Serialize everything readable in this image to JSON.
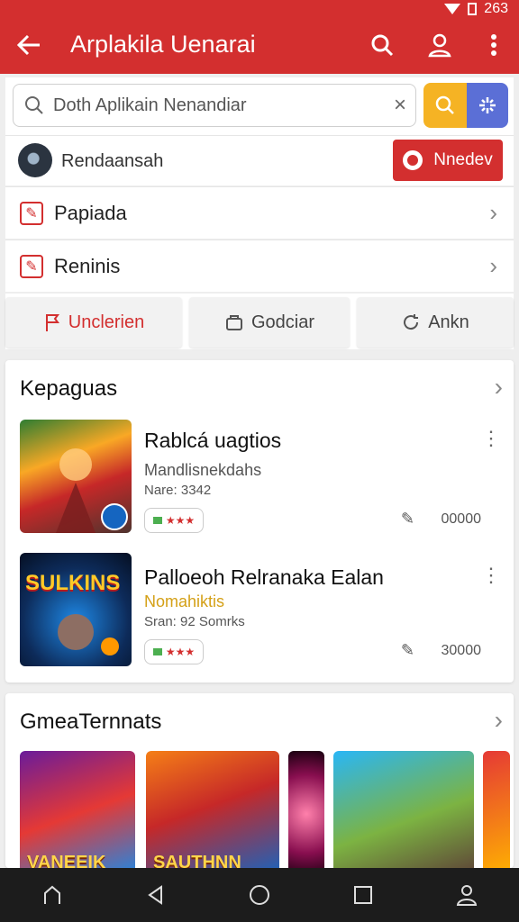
{
  "status_bar": {
    "time": "263"
  },
  "appbar": {
    "title": "Arplakila Uenarai",
    "back_icon": "arrow-left-icon",
    "actions": [
      "search-icon",
      "user-icon",
      "more-vert-icon"
    ]
  },
  "search": {
    "placeholder": "Doth Aplikain Nenandiar",
    "clear_icon": "close-icon",
    "search_button_icon": "search-icon",
    "filter_button_icon": "sparkle-icon"
  },
  "user": {
    "name": "Rendaansah",
    "button_label": "Nnedev"
  },
  "menu": [
    {
      "label": "Papiada",
      "icon": "edit-icon"
    },
    {
      "label": "Reninis",
      "icon": "edit-icon"
    }
  ],
  "tabs": [
    {
      "label": "Unclerien",
      "icon": "flag-icon",
      "active": true
    },
    {
      "label": "Godciar",
      "icon": "bag-icon",
      "active": false
    },
    {
      "label": "Ankn",
      "icon": "refresh-icon",
      "active": false
    }
  ],
  "section1": {
    "title": "Kepaguas",
    "games": [
      {
        "title": "Rablcá uagtios",
        "subtitle": "Mandlisnekdahs",
        "meta": "Nare: 3342",
        "chip": "★★★",
        "count": "00000"
      },
      {
        "title": "Palloeoh Relranaka Ealan",
        "subtitle": "Nomahiktis",
        "meta": "Sran: 92 Somrks",
        "chip": "★★★",
        "count": "30000",
        "thumb_text": "SULKINS"
      }
    ]
  },
  "section2": {
    "title": "GmeaTernnats",
    "tiles": [
      {
        "caption": "VANEEIK"
      },
      {
        "caption": "SAUTHNN"
      },
      {
        "caption": ""
      },
      {
        "caption": ""
      },
      {
        "caption": ""
      }
    ]
  },
  "colors": {
    "primary": "#d32f2f",
    "search_button": "#f5b324",
    "filter_button": "#5b6fd6"
  }
}
